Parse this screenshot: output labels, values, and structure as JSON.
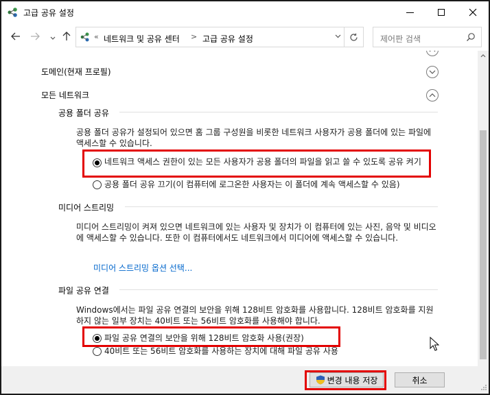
{
  "window": {
    "title": "고급 공유 설정"
  },
  "address": {
    "chevron": "«",
    "crumbs": [
      "네트워크 및 공유 센터",
      "고급 공유 설정"
    ],
    "separator": ">"
  },
  "search": {
    "placeholder": "제어판 검색"
  },
  "profiles": {
    "domain_label": "도메인(현재 프로필)",
    "all_networks_label": "모든 네트워크"
  },
  "public_folder": {
    "title": "공용 폴더 공유",
    "description": "공용 폴더 공유가 설정되어 있으면 홈 그룹 구성원을 비롯한 네트워크 사용자가 공용 폴더에 있는 파일에 액세스할 수 있습니다.",
    "option_on": "네트워크 액세스 권한이 있는 모든 사용자가 공용 폴더의 파일을 읽고 쓸 수 있도록 공유 켜기",
    "option_off": "공용 폴더 공유 끄기(이 컴퓨터에 로그온한 사용자는 이 폴더에 계속 액세스할 수 있음)"
  },
  "media": {
    "title": "미디어 스트리밍",
    "description": "미디어 스트리밍이 켜져 있으면 네트워크에 있는 사용자 및 장치가 이 컴퓨터에 있는 사진, 음악 및 비디오에 액세스할 수 있습니다. 또한 이 컴퓨터에서도 네트워크에서 미디어에 액세스할 수 있습니다.",
    "link": "미디어 스트리밍 옵션 선택..."
  },
  "file_sharing": {
    "title": "파일 공유 연결",
    "description": "Windows에서는 파일 공유 연결의 보안을 위해 128비트 암호화를 사용합니다. 128비트 암호화를 지원하지 않는 일부 장치는 40비트 또는 56비트 암호화를 사용해야 합니다.",
    "option_128": "파일 공유 연결의 보안을 위해 128비트 암호화 사용(권장)",
    "option_40_56": "40비트 또는 56비트 암호화를 사용하는 장치에 대해 파일 공유 사용"
  },
  "buttons": {
    "save": "변경 내용 저장",
    "cancel": "취소"
  },
  "colors": {
    "highlight": "#e30000",
    "link": "#0066cc"
  }
}
